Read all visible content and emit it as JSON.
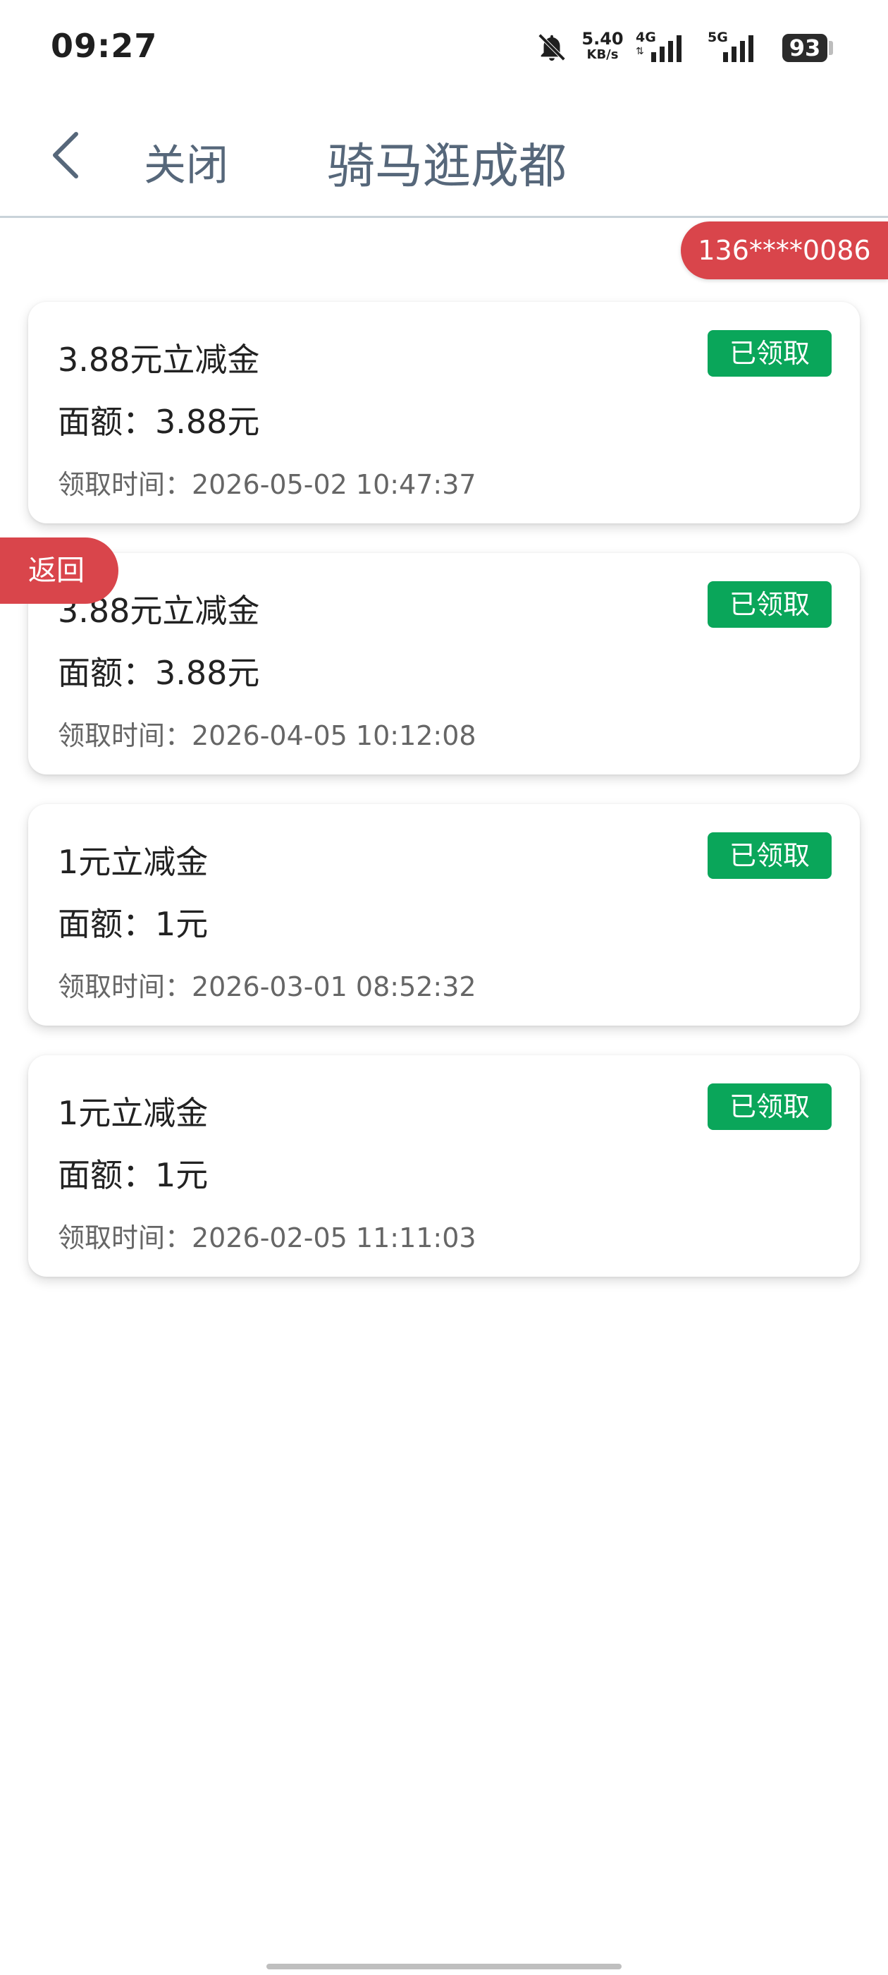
{
  "status_bar": {
    "time": "09:27",
    "speed_value": "5.40",
    "speed_unit": "KB/s",
    "net1": "4G",
    "net2": "5G",
    "battery": "93"
  },
  "header": {
    "close_label": "关闭",
    "title": "骑马逛成都"
  },
  "phone_badge": "136****0086",
  "back_badge": "返回",
  "coupons": [
    {
      "title": "3.88元立减金",
      "amount": "面额：3.88元",
      "time": "领取时间：2026-05-02 10:47:37",
      "status": "已领取"
    },
    {
      "title": "3.88元立减金",
      "amount": "面额：3.88元",
      "time": "领取时间：2026-04-05 10:12:08",
      "status": "已领取"
    },
    {
      "title": "1元立减金",
      "amount": "面额：1元",
      "time": "领取时间：2026-03-01 08:52:32",
      "status": "已领取"
    },
    {
      "title": "1元立减金",
      "amount": "面额：1元",
      "time": "领取时间：2026-02-05 11:11:03",
      "status": "已领取"
    }
  ],
  "colors": {
    "accent_red": "#d9454b",
    "claimed_green": "#0aa65a",
    "header_text": "#56677a"
  },
  "icons": [
    "bell-muted-icon",
    "signal-bars-icon",
    "battery-icon",
    "chevron-left-icon"
  ]
}
